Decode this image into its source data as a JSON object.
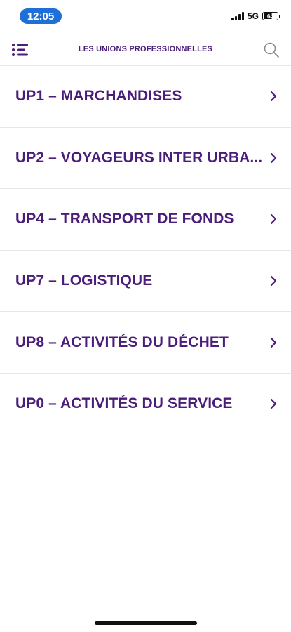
{
  "status_bar": {
    "time": "12:05",
    "network": "5G",
    "battery": "64",
    "battery_level": 0.64
  },
  "header": {
    "title": "LES UNIONS PROFESSIONNELLES",
    "menu_icon": "menu-list-icon",
    "search_icon": "search-icon"
  },
  "colors": {
    "primary": "#4b1d7a",
    "time_pill": "#1f6fd9",
    "header_border": "#f3e6c4",
    "divider": "#e6e6e6"
  },
  "list": {
    "items": [
      {
        "label": "UP1 – MARCHANDISES"
      },
      {
        "label": "UP2 – VOYAGEURS INTER URBA..."
      },
      {
        "label": "UP4 – TRANSPORT DE FONDS"
      },
      {
        "label": "UP7 – LOGISTIQUE"
      },
      {
        "label": "UP8 – ACTIVITÉS DU DÉCHET"
      },
      {
        "label": "UP0 – ACTIVITÉS DU SERVICE"
      }
    ]
  }
}
